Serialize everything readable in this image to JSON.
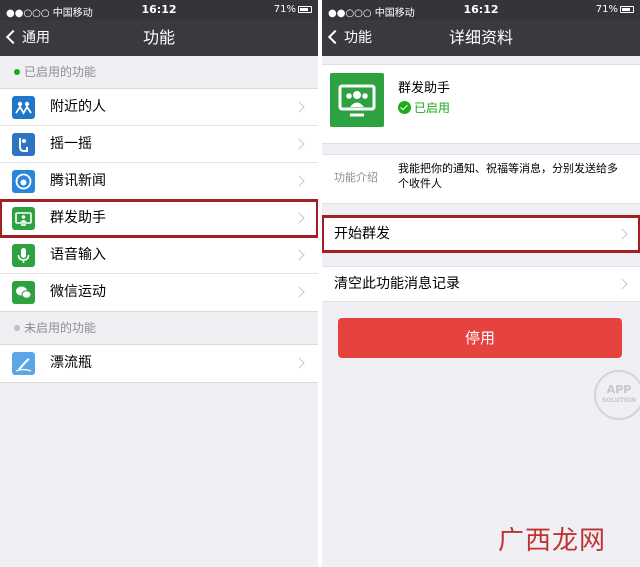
{
  "status_bar": {
    "carrier": "●●○○○ 中国移动",
    "time": "16:12",
    "battery": "71%"
  },
  "left": {
    "nav_back": "通用",
    "title": "功能",
    "enabled_header": "已启用的功能",
    "disabled_header": "未启用的功能",
    "enabled_items": [
      {
        "label": "附近的人",
        "icon": "people-nearby-icon",
        "color": "#1f77c7"
      },
      {
        "label": "摇一摇",
        "icon": "shake-icon",
        "color": "#2d74c4"
      },
      {
        "label": "腾讯新闻",
        "icon": "news-icon",
        "color": "#2a86d8"
      },
      {
        "label": "群发助手",
        "icon": "broadcast-icon",
        "color": "#2ea241"
      },
      {
        "label": "语音输入",
        "icon": "microphone-icon",
        "color": "#2ea241"
      },
      {
        "label": "微信运动",
        "icon": "wechat-sports-icon",
        "color": "#2ea241"
      }
    ],
    "disabled_items": [
      {
        "label": "漂流瓶",
        "icon": "drift-bottle-icon",
        "color": "#5aa6e6"
      }
    ]
  },
  "right": {
    "nav_back": "功能",
    "title": "详细资料",
    "feature_name": "群发助手",
    "feature_status": "已启用",
    "intro_label": "功能介绍",
    "intro_text": "我能把你的通知、祝福等消息，分别发送给多个收件人",
    "action_start": "开始群发",
    "action_clear": "清空此功能消息记录",
    "disable_button": "停用"
  },
  "watermark": {
    "badge_title": "APP",
    "badge_sub": "SOLUTION",
    "site": "广西龙网"
  },
  "colors": {
    "accent_green": "#1aad19",
    "danger_red": "#e64340",
    "highlight_border": "#a31f24",
    "navbar": "#393a3f"
  }
}
